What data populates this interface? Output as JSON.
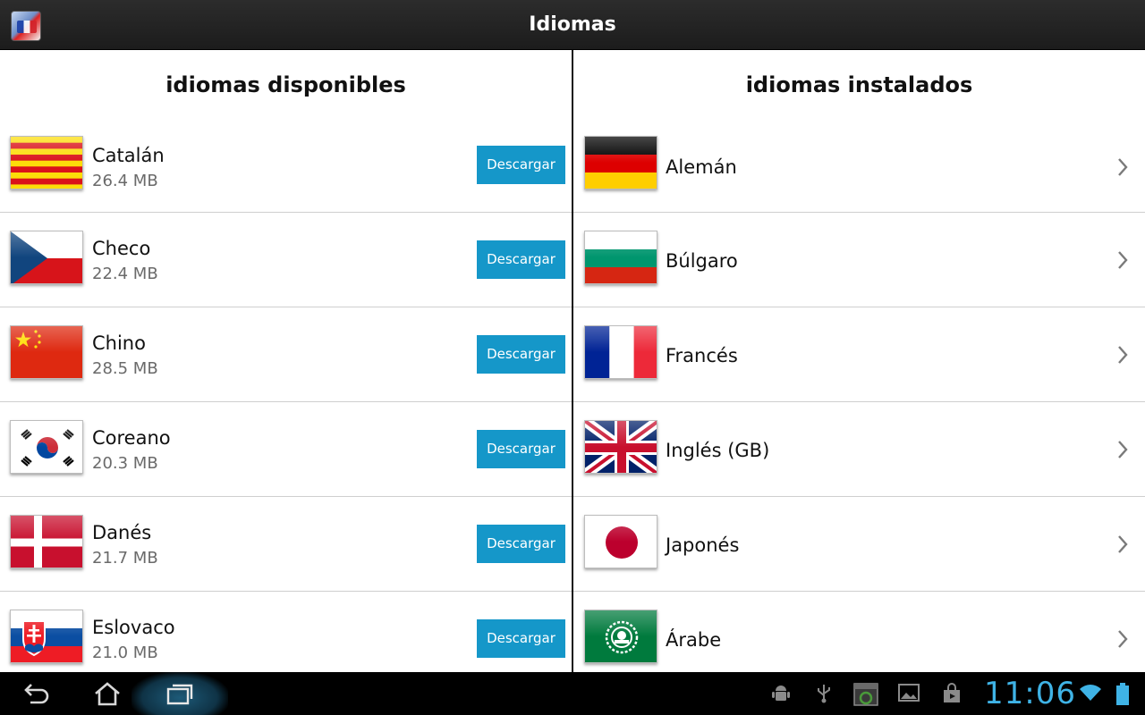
{
  "window": {
    "title": "Idiomas"
  },
  "available": {
    "header": "idiomas disponibles",
    "button_label": "Descargar",
    "items": [
      {
        "name": "Catalán",
        "size": "26.4 MB",
        "flag": "catalonia-flag"
      },
      {
        "name": "Checo",
        "size": "22.4 MB",
        "flag": "czech-flag"
      },
      {
        "name": "Chino",
        "size": "28.5 MB",
        "flag": "china-flag"
      },
      {
        "name": "Coreano",
        "size": "20.3 MB",
        "flag": "korea-flag"
      },
      {
        "name": "Danés",
        "size": "21.7 MB",
        "flag": "denmark-flag"
      },
      {
        "name": "Eslovaco",
        "size": "21.0 MB",
        "flag": "slovakia-flag"
      }
    ]
  },
  "installed": {
    "header": "idiomas instalados",
    "items": [
      {
        "name": "Alemán",
        "flag": "germany-flag"
      },
      {
        "name": "Búlgaro",
        "flag": "bulgaria-flag"
      },
      {
        "name": "Francés",
        "flag": "france-flag"
      },
      {
        "name": "Inglés (GB)",
        "flag": "uk-flag"
      },
      {
        "name": "Japonés",
        "flag": "japan-flag"
      },
      {
        "name": "Árabe",
        "flag": "arab-league-flag"
      }
    ]
  },
  "system_bar": {
    "time": "11:06",
    "nav_icons": [
      "back-icon",
      "home-icon",
      "recent-apps-icon"
    ],
    "status_icons": [
      "android-debug-icon",
      "usb-icon",
      "screenshot-icon",
      "gallery-icon",
      "store-icon",
      "wifi-icon",
      "battery-icon"
    ]
  },
  "colors": {
    "accent": "#1597c9",
    "title_bar": "#222222",
    "clock": "#3fb3e6"
  }
}
